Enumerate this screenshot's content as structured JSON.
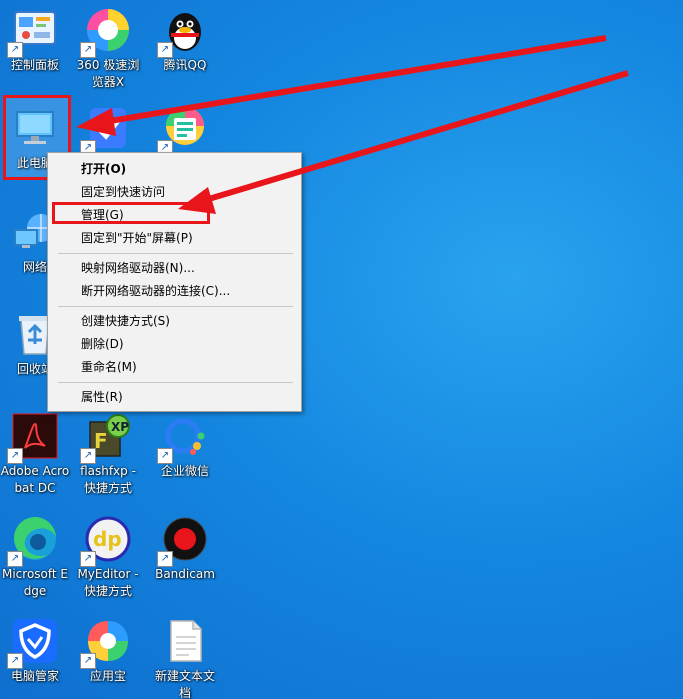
{
  "desktop": {
    "icons": [
      {
        "name": "control-panel",
        "label": "控制面板",
        "shortcut": true
      },
      {
        "name": "360-browser",
        "label": "360 极速浏览器X",
        "shortcut": true
      },
      {
        "name": "tencent-qq",
        "label": "腾讯QQ",
        "shortcut": true
      },
      {
        "name": "this-pc",
        "label": "此电脑",
        "shortcut": false
      },
      {
        "name": "blue-app",
        "label": "",
        "shortcut": true
      },
      {
        "name": "image-app",
        "label": "",
        "shortcut": true
      },
      {
        "name": "network",
        "label": "网络",
        "shortcut": false
      },
      {
        "name": "recycle-bin",
        "label": "回收站",
        "shortcut": false
      },
      {
        "name": "adobe-acrobat",
        "label": "Adobe Acrobat DC",
        "shortcut": true
      },
      {
        "name": "flashfxp",
        "label": "flashfxp - 快捷方式",
        "shortcut": true
      },
      {
        "name": "wecom",
        "label": "企业微信",
        "shortcut": true
      },
      {
        "name": "microsoft-edge",
        "label": "Microsoft Edge",
        "shortcut": true
      },
      {
        "name": "myeditor",
        "label": "MyEditor - 快捷方式",
        "shortcut": true
      },
      {
        "name": "bandicam",
        "label": "Bandicam",
        "shortcut": true
      },
      {
        "name": "pc-manager",
        "label": "电脑管家",
        "shortcut": true
      },
      {
        "name": "app-store",
        "label": "应用宝",
        "shortcut": true
      },
      {
        "name": "new-text-doc",
        "label": "新建文本文档",
        "shortcut": false
      }
    ],
    "shortcut_glyph": "↗"
  },
  "context_menu": {
    "open": "打开(O)",
    "pin_quick_access": "固定到快速访问",
    "manage": "管理(G)",
    "pin_start": "固定到\"开始\"屏幕(P)",
    "map_drive": "映射网络驱动器(N)...",
    "disconnect_drive": "断开网络驱动器的连接(C)...",
    "create_shortcut": "创建快捷方式(S)",
    "delete": "删除(D)",
    "rename": "重命名(M)",
    "properties": "属性(R)"
  },
  "colors": {
    "annotation_red": "#e8161b",
    "desktop_blue": "#1487e0"
  }
}
